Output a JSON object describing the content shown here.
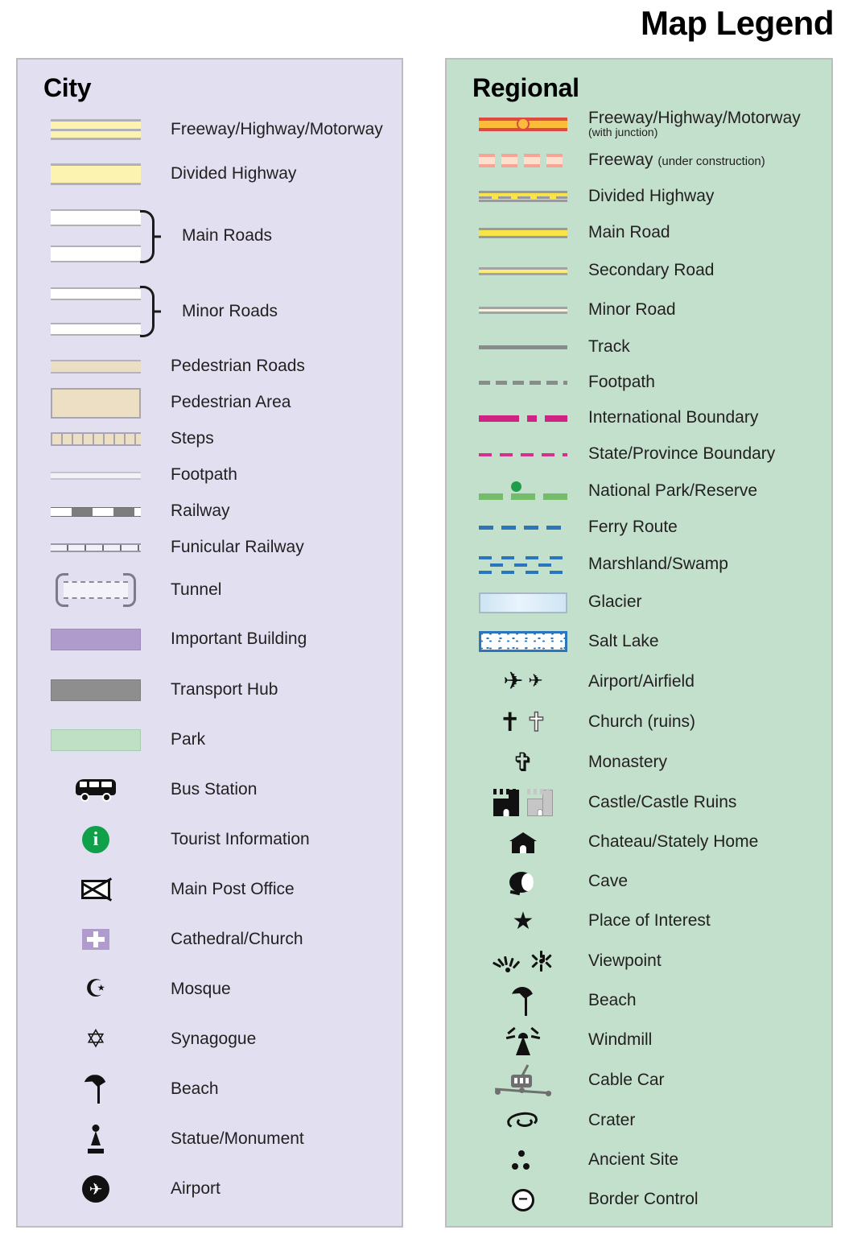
{
  "title": "Map Legend",
  "city": {
    "heading": "City",
    "items": [
      {
        "label": "Freeway/Highway/Motorway",
        "symbol": "city-freeway-swatch"
      },
      {
        "label": "Divided Highway",
        "symbol": "city-divided-highway-swatch"
      },
      {
        "label": "Main Roads",
        "symbol": "city-main-roads-swatch"
      },
      {
        "label": "Minor Roads",
        "symbol": "city-minor-roads-swatch"
      },
      {
        "label": "Pedestrian Roads",
        "symbol": "city-pedestrian-road-swatch"
      },
      {
        "label": "Pedestrian Area",
        "symbol": "city-pedestrian-area-swatch"
      },
      {
        "label": "Steps",
        "symbol": "city-steps-swatch"
      },
      {
        "label": "Footpath",
        "symbol": "city-footpath-swatch"
      },
      {
        "label": "Railway",
        "symbol": "city-railway-swatch"
      },
      {
        "label": "Funicular Railway",
        "symbol": "city-funicular-swatch"
      },
      {
        "label": "Tunnel",
        "symbol": "city-tunnel-swatch"
      },
      {
        "label": "Important Building",
        "symbol": "city-important-building-swatch"
      },
      {
        "label": "Transport Hub",
        "symbol": "city-transport-hub-swatch"
      },
      {
        "label": "Park",
        "symbol": "city-park-swatch"
      },
      {
        "label": "Bus Station",
        "symbol": "bus-icon"
      },
      {
        "label": "Tourist Information",
        "symbol": "info-icon"
      },
      {
        "label": "Main Post Office",
        "symbol": "envelope-icon"
      },
      {
        "label": "Cathedral/Church",
        "symbol": "cross-square-icon"
      },
      {
        "label": "Mosque",
        "symbol": "crescent-star-icon"
      },
      {
        "label": "Synagogue",
        "symbol": "star-of-david-icon"
      },
      {
        "label": "Beach",
        "symbol": "parasol-icon"
      },
      {
        "label": "Statue/Monument",
        "symbol": "statue-icon"
      },
      {
        "label": "Airport",
        "symbol": "airplane-circle-icon"
      }
    ]
  },
  "regional": {
    "heading": "Regional",
    "items": [
      {
        "label": "Freeway/Highway/Motorway",
        "sub": "(with junction)",
        "symbol": "regional-freeway-swatch"
      },
      {
        "label": "Freeway",
        "sub": "(under construction)",
        "symbol": "regional-freeway-construction-swatch"
      },
      {
        "label": "Divided Highway",
        "symbol": "regional-divided-highway-swatch"
      },
      {
        "label": "Main Road",
        "symbol": "regional-main-road-swatch"
      },
      {
        "label": "Secondary Road",
        "symbol": "regional-secondary-road-swatch"
      },
      {
        "label": "Minor Road",
        "symbol": "regional-minor-road-swatch"
      },
      {
        "label": "Track",
        "symbol": "regional-track-swatch"
      },
      {
        "label": "Footpath",
        "symbol": "regional-footpath-swatch"
      },
      {
        "label": "International Boundary",
        "symbol": "international-boundary-swatch"
      },
      {
        "label": "State/Province Boundary",
        "symbol": "state-boundary-swatch"
      },
      {
        "label": "National Park/Reserve",
        "symbol": "national-park-swatch"
      },
      {
        "label": "Ferry Route",
        "symbol": "ferry-route-swatch"
      },
      {
        "label": "Marshland/Swamp",
        "symbol": "marshland-swatch"
      },
      {
        "label": "Glacier",
        "symbol": "glacier-swatch"
      },
      {
        "label": "Salt Lake",
        "symbol": "salt-lake-swatch"
      },
      {
        "label": "Airport/Airfield",
        "symbol": "airplane-icon"
      },
      {
        "label": "Church (ruins)",
        "symbol": "cross-icon"
      },
      {
        "label": "Monastery",
        "symbol": "monastery-cross-icon"
      },
      {
        "label": "Castle/Castle Ruins",
        "symbol": "castle-icon"
      },
      {
        "label": "Chateau/Stately Home",
        "symbol": "chateau-icon"
      },
      {
        "label": "Cave",
        "symbol": "cave-icon"
      },
      {
        "label": "Place of Interest",
        "symbol": "star-icon"
      },
      {
        "label": "Viewpoint",
        "symbol": "viewpoint-icon"
      },
      {
        "label": "Beach",
        "symbol": "parasol-icon"
      },
      {
        "label": "Windmill",
        "symbol": "windmill-icon"
      },
      {
        "label": "Cable Car",
        "symbol": "cable-car-icon"
      },
      {
        "label": "Crater",
        "symbol": "crater-icon"
      },
      {
        "label": "Ancient Site",
        "symbol": "ancient-site-icon"
      },
      {
        "label": "Border Control",
        "symbol": "border-control-icon"
      }
    ]
  },
  "colors": {
    "city_panel_bg": "#e1dff0",
    "regional_panel_bg": "#c2e0cb",
    "panel_border": "#bdbdbd",
    "highway_yellow": "#fdf3b0",
    "pedestrian_tan": "#eddfc4",
    "important_building_purple": "#b09ccc",
    "transport_hub_grey": "#8e8e8e",
    "park_green": "#bfe0c4",
    "freeway_red": "#dd4a43",
    "freeway_orange": "#fcbb3b",
    "road_yellow": "#f9e34a",
    "boundary_magenta": "#cf2384",
    "water_blue": "#2a75bb",
    "park_dash_green": "#74bb6a",
    "info_green": "#11a04a",
    "text": "#231f20"
  }
}
